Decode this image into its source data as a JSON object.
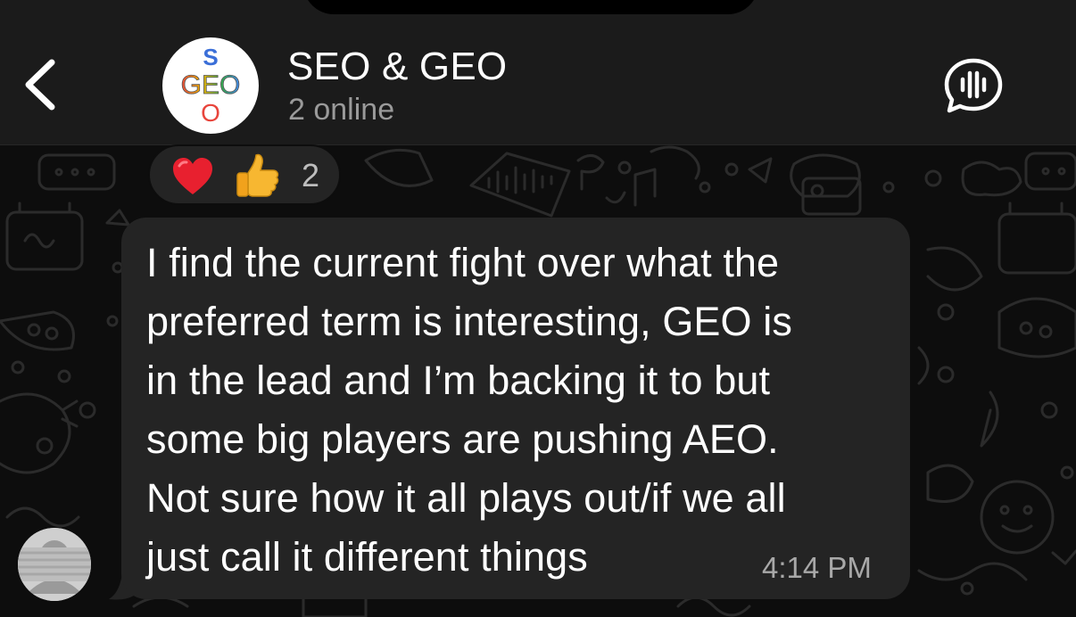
{
  "header": {
    "title": "SEO & GEO",
    "status": "2 online",
    "back_icon": "chevron-left-icon",
    "voice_icon": "voice-chat-icon"
  },
  "group_avatar": {
    "letter_top": "S",
    "word_middle": "GEO",
    "letter_bottom": "O"
  },
  "message": {
    "text": "I find the current fight over what the\npreferred term is interesting, GEO is\nin the lead and I’m backing it to but\nsome big players are pushing AEO.\nNot sure how it all plays out/if we all\njust call it different things",
    "time": "4:14 PM",
    "reactions": {
      "emojis": [
        "red-heart",
        "thumbs-up"
      ],
      "count": "2"
    }
  },
  "colors": {
    "header_bg": "#1b1b1b",
    "bubble_bg": "#242424",
    "wallpaper_bg": "#0d0d0d",
    "doodle": "#2a2a2a",
    "secondary_text": "#9a9a9a"
  }
}
